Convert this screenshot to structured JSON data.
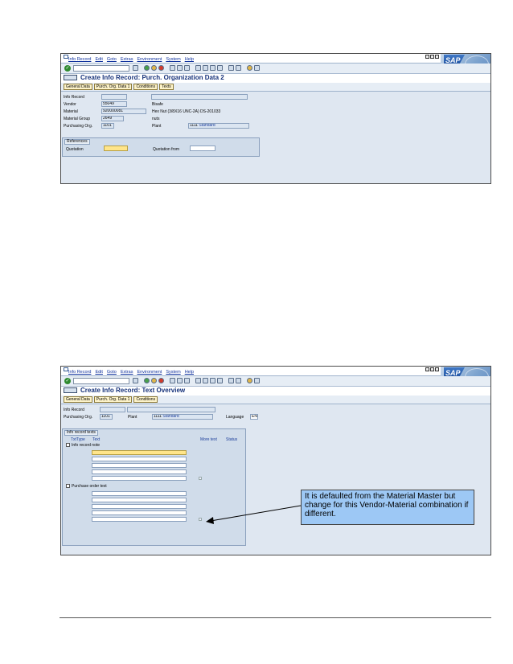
{
  "menu": [
    "Info Record",
    "Edit",
    "Goto",
    "Extras",
    "Environment",
    "System",
    "Help"
  ],
  "logo": "SAP",
  "screen1": {
    "title": "Create Info Record: Purch. Organization Data 2",
    "tabs": [
      "General Data",
      "Purch. Org. Data 1",
      "Conditions",
      "Texts"
    ],
    "labels": {
      "info_record": "Info Record",
      "vendor": "Vendor",
      "material": "Material",
      "material_group": "Material Group",
      "purchasing_org": "Purchasing Org.",
      "plant": "Plant"
    },
    "values": {
      "vendor": "55049",
      "vendor_name": "Bisafe",
      "material": "920000081",
      "material_desc": "Hex Nut (3/8X16 UNC-2A) DS-201033",
      "material_group": "2649",
      "material_group_desc": "nuts",
      "purchasing_org": "1101",
      "plant": "1111",
      "plant_name": "Standard"
    },
    "references": {
      "title": "References",
      "quotation": "Quotation",
      "quotation_from": "Quotation from"
    }
  },
  "screen2": {
    "title": "Create Info Record: Text Overview",
    "tabs": [
      "General Data",
      "Purch. Org. Data 1",
      "Conditions"
    ],
    "labels": {
      "info_record": "Info Record",
      "purchasing_org": "Purchasing Org.",
      "plant": "Plant",
      "language": "Language"
    },
    "values": {
      "purchasing_org": "1101",
      "plant": "1111",
      "plant_name": "Standard",
      "language": "EN"
    },
    "texts_group": {
      "title": "Info record texts",
      "col_txtype": "TxtType",
      "col_text": "Text",
      "col_more": "More text",
      "col_status": "Status",
      "info_record_note": "Info record note",
      "purchase_order_text": "Purchase order text"
    }
  },
  "callout": "It is defaulted from the Material Master but change for this Vendor-Material combination if different."
}
